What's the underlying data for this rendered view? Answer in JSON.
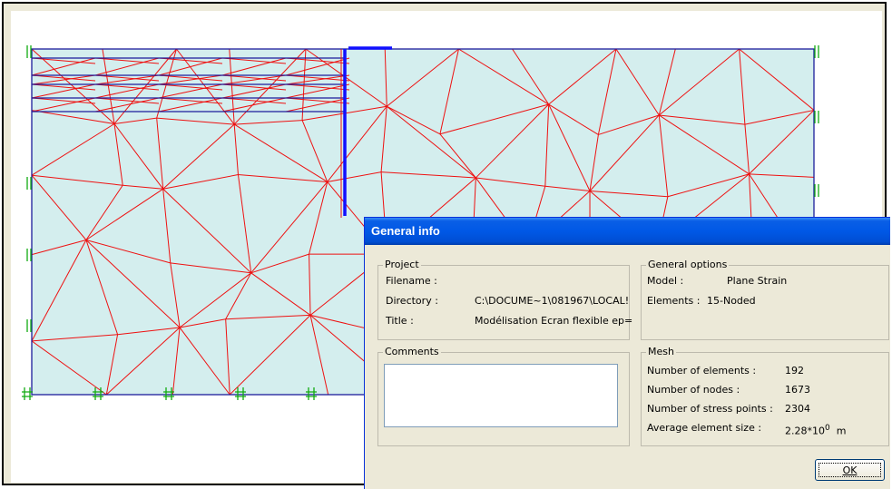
{
  "dialog": {
    "title": "General info",
    "project": {
      "title": "Project",
      "filename_label": "Filename :",
      "filename_value": "",
      "directory_label": "Directory :",
      "directory_value": "C:\\DOCUME~1\\081967\\LOCAL!",
      "title_label": "Title :",
      "title_value": "Modélisation Ecran flexible ep="
    },
    "general_options": {
      "title": "General options",
      "model_label": "Model :",
      "model_value": "Plane Strain",
      "elements_label": "Elements :",
      "elements_value": "15-Noded"
    },
    "comments": {
      "title": "Comments",
      "value": ""
    },
    "mesh": {
      "title": "Mesh",
      "num_elements_label": "Number of elements :",
      "num_elements_value": "192",
      "num_nodes_label": "Number of nodes :",
      "num_nodes_value": "1673",
      "num_stress_label": "Number of stress points :",
      "num_stress_value": "2304",
      "avg_size_label": "Average element size :",
      "avg_size_mantissa": "2.28*10",
      "avg_size_exponent": "0",
      "avg_size_unit": "m"
    },
    "ok_label": "OK"
  },
  "colors": {
    "mesh_fill": "#d4eeee",
    "mesh_lines": "#ee1111",
    "boundary": "#1c1c9c",
    "wall": "#1010ff",
    "fixity": "#11aa11",
    "title_bar": "#0054e3"
  }
}
